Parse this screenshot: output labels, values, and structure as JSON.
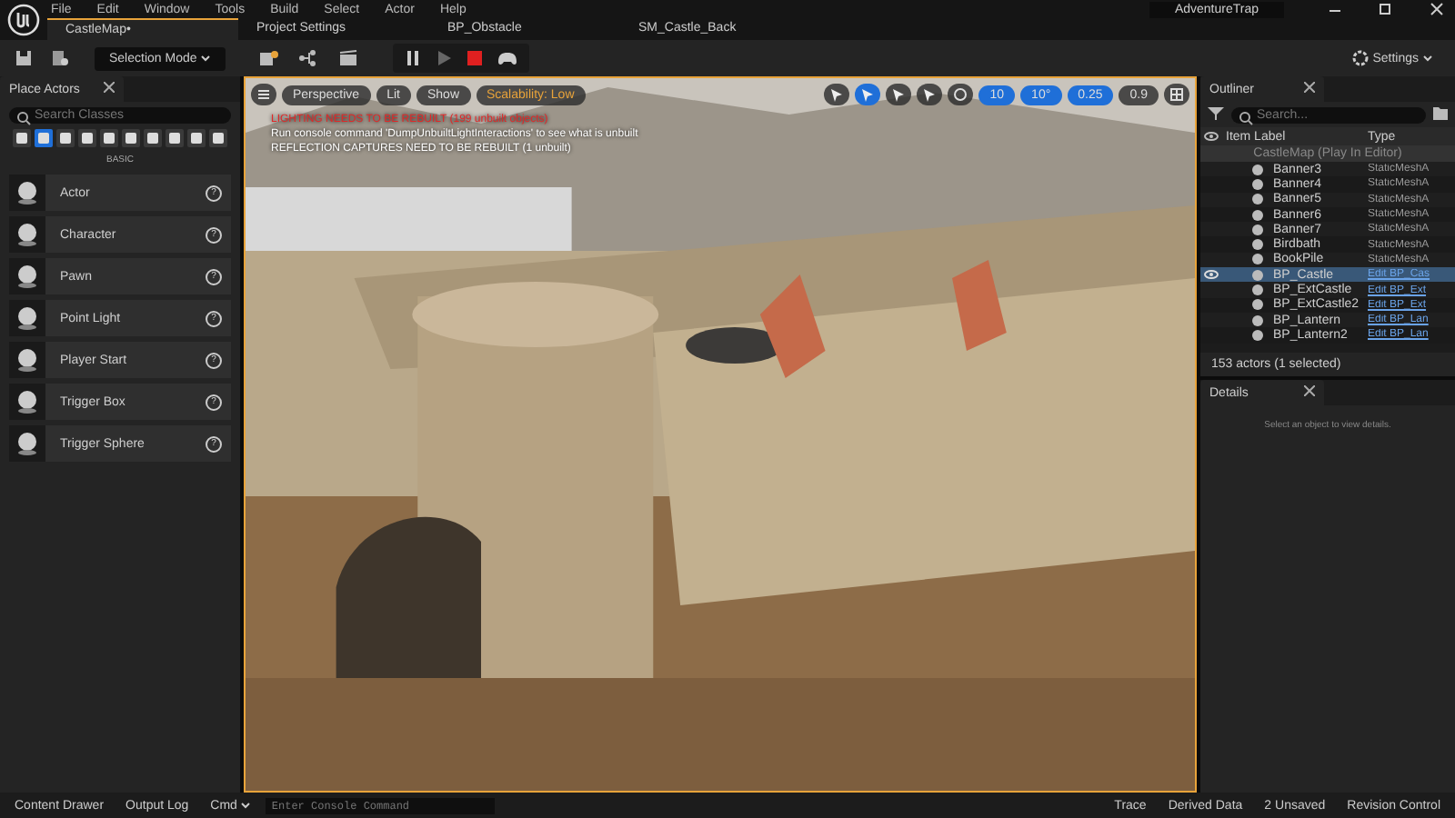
{
  "menu": [
    "File",
    "Edit",
    "Window",
    "Tools",
    "Build",
    "Select",
    "Actor",
    "Help"
  ],
  "project": "AdventureTrap",
  "tabs": [
    {
      "label": "CastleMap•",
      "selected": true
    },
    {
      "label": "Project Settings",
      "selected": false
    },
    {
      "label": "BP_Obstacle",
      "selected": false
    },
    {
      "label": "SM_Castle_Back",
      "selected": false
    }
  ],
  "toolbar": {
    "mode": "Selection Mode",
    "settings": "Settings"
  },
  "place_actors": {
    "title": "Place Actors",
    "search": {
      "placeholder": "Search Classes"
    },
    "categories": [
      {
        "selected": false
      },
      {
        "selected": true
      },
      {
        "selected": false
      },
      {
        "selected": false
      },
      {
        "selected": false
      },
      {
        "selected": false
      },
      {
        "selected": false
      },
      {
        "selected": false
      },
      {
        "selected": false
      },
      {
        "selected": false
      }
    ],
    "section": "BASIC",
    "items": [
      {
        "label": "Actor",
        "help": "?"
      },
      {
        "label": "Character",
        "help": "?"
      },
      {
        "label": "Pawn",
        "help": "?"
      },
      {
        "label": "Point Light",
        "help": "?"
      },
      {
        "label": "Player Start",
        "help": "?"
      },
      {
        "label": "Trigger Box",
        "help": "?"
      },
      {
        "label": "Trigger Sphere",
        "help": "?"
      }
    ]
  },
  "viewport": {
    "buttons": [
      "Perspective",
      "Lit",
      "Show"
    ],
    "scalability": "Scalability: Low",
    "warnings": [
      {
        "kind": "error",
        "text": "LIGHTING NEEDS TO BE REBUILT (199 unbuilt objects)"
      },
      {
        "kind": "info",
        "text": "Run console command 'DumpUnbuiltLightInteractions' to see what is unbuilt"
      },
      {
        "kind": "info",
        "text": "REFLECTION CAPTURES NEED TO BE REBUILT (1 unbuilt)"
      }
    ],
    "tools": [
      {
        "selected": false
      },
      {
        "selected": true
      },
      {
        "selected": false
      },
      {
        "selected": false
      }
    ],
    "snaps": [
      {
        "label": "10",
        "on": true
      },
      {
        "label": "10°",
        "on": true
      },
      {
        "label": "0.25",
        "on": true
      }
    ],
    "camera_speed": "0.9"
  },
  "outliner": {
    "title": "Outliner",
    "search": {
      "placeholder": "Search..."
    },
    "columns": [
      "Item Label",
      "Type"
    ],
    "header": "CastleMap (Play In Editor)",
    "rows": [
      {
        "label": "Banner3",
        "type": "StaticMeshA",
        "link": false,
        "selected": false
      },
      {
        "label": "Banner4",
        "type": "StaticMeshA",
        "link": false,
        "selected": false
      },
      {
        "label": "Banner5",
        "type": "StaticMeshA",
        "link": false,
        "selected": false
      },
      {
        "label": "Banner6",
        "type": "StaticMeshA",
        "link": false,
        "selected": false
      },
      {
        "label": "Banner7",
        "type": "StaticMeshA",
        "link": false,
        "selected": false
      },
      {
        "label": "Birdbath",
        "type": "StaticMeshA",
        "link": false,
        "selected": false
      },
      {
        "label": "BookPile",
        "type": "StaticMeshA",
        "link": false,
        "selected": false
      },
      {
        "label": "BP_Castle",
        "type": "Edit BP_Cas",
        "link": true,
        "selected": true
      },
      {
        "label": "BP_ExtCastle",
        "type": "Edit BP_Ext",
        "link": true,
        "selected": false
      },
      {
        "label": "BP_ExtCastle2",
        "type": "Edit BP_Ext",
        "link": true,
        "selected": false
      },
      {
        "label": "BP_Lantern",
        "type": "Edit BP_Lan",
        "link": true,
        "selected": false
      },
      {
        "label": "BP_Lantern2",
        "type": "Edit BP_Lan",
        "link": true,
        "selected": false
      }
    ],
    "footer": "153 actors (1 selected)"
  },
  "details": {
    "title": "Details",
    "empty": "Select an object to view details."
  },
  "status": {
    "left": [
      "Content Drawer",
      "Output Log"
    ],
    "cmd": "Cmd",
    "console": {
      "placeholder": "Enter Console Command"
    },
    "right": [
      "Trace",
      "Derived Data",
      "2 Unsaved",
      "Revision Control"
    ]
  }
}
